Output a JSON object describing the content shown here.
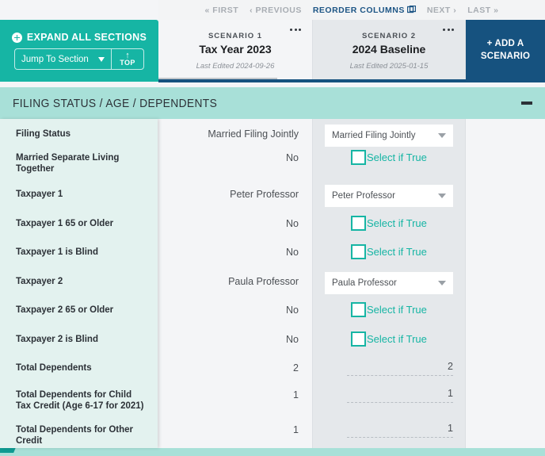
{
  "pager": {
    "first": "« FIRST",
    "previous": "‹ PREVIOUS",
    "reorder": "REORDER COLUMNS",
    "reorder_icon": "columns-icon",
    "next": "NEXT ›",
    "last": "LAST »"
  },
  "toolbar": {
    "expand_all_label": "EXPAND ALL SECTIONS",
    "expand_icon": "plus-circle-icon",
    "jump_to_section_value": "Jump To Section",
    "jump_chevron_icon": "chevron-down-icon",
    "top_arrow_icon": "arrow-up-icon",
    "top_label": "TOP"
  },
  "scenarios": [
    {
      "kicker": "SCENARIO 1",
      "name": "Tax Year 2023",
      "last_edited": "Last Edited 2024-09-26",
      "menu_icon": "ellipsis-icon"
    },
    {
      "kicker": "SCENARIO 2",
      "name": "2024 Baseline",
      "last_edited": "Last Edited 2025-01-15",
      "menu_icon": "ellipsis-icon"
    }
  ],
  "add_scenario": {
    "label": "+ ADD A SCENARIO"
  },
  "section": {
    "title": "FILING STATUS / AGE / DEPENDENTS",
    "collapse_icon": "minus-icon"
  },
  "rows": [
    {
      "label": "Filing Status",
      "s1_value": "Married Filing Jointly",
      "s2_type": "select",
      "s2_value": "Married Filing Jointly"
    },
    {
      "label": "Married Separate Living Together",
      "s1_value": "No",
      "s2_type": "checkbox",
      "s2_value": "Select if True"
    },
    {
      "label": "Taxpayer 1",
      "s1_value": "Peter Professor",
      "s2_type": "select",
      "s2_value": "Peter Professor"
    },
    {
      "label": "Taxpayer 1 65 or Older",
      "s1_value": "No",
      "s2_type": "checkbox",
      "s2_value": "Select if True"
    },
    {
      "label": "Taxpayer 1 is Blind",
      "s1_value": "No",
      "s2_type": "checkbox",
      "s2_value": "Select if True"
    },
    {
      "label": "Taxpayer 2",
      "s1_value": "Paula Professor",
      "s2_type": "select",
      "s2_value": "Paula Professor"
    },
    {
      "label": "Taxpayer 2 65 or Older",
      "s1_value": "No",
      "s2_type": "checkbox",
      "s2_value": "Select if True"
    },
    {
      "label": "Taxpayer 2 is Blind",
      "s1_value": "No",
      "s2_type": "checkbox",
      "s2_value": "Select if True"
    },
    {
      "label": "Total Dependents",
      "s1_value": "2",
      "s2_type": "number",
      "s2_value": "2"
    },
    {
      "label": "Total Dependents for Child Tax Credit (Age 6-17 for 2021)",
      "s1_value": "1",
      "s2_type": "number",
      "s2_value": "1"
    },
    {
      "label": "Total Dependents for Other Credit",
      "s1_value": "1",
      "s2_type": "number",
      "s2_value": "1"
    }
  ],
  "colors": {
    "teal": "#16b5a4",
    "teal_light": "#a8e0d8",
    "panel_light": "#e3f2ef",
    "navy": "#16527f",
    "link_active": "#1d5585"
  }
}
